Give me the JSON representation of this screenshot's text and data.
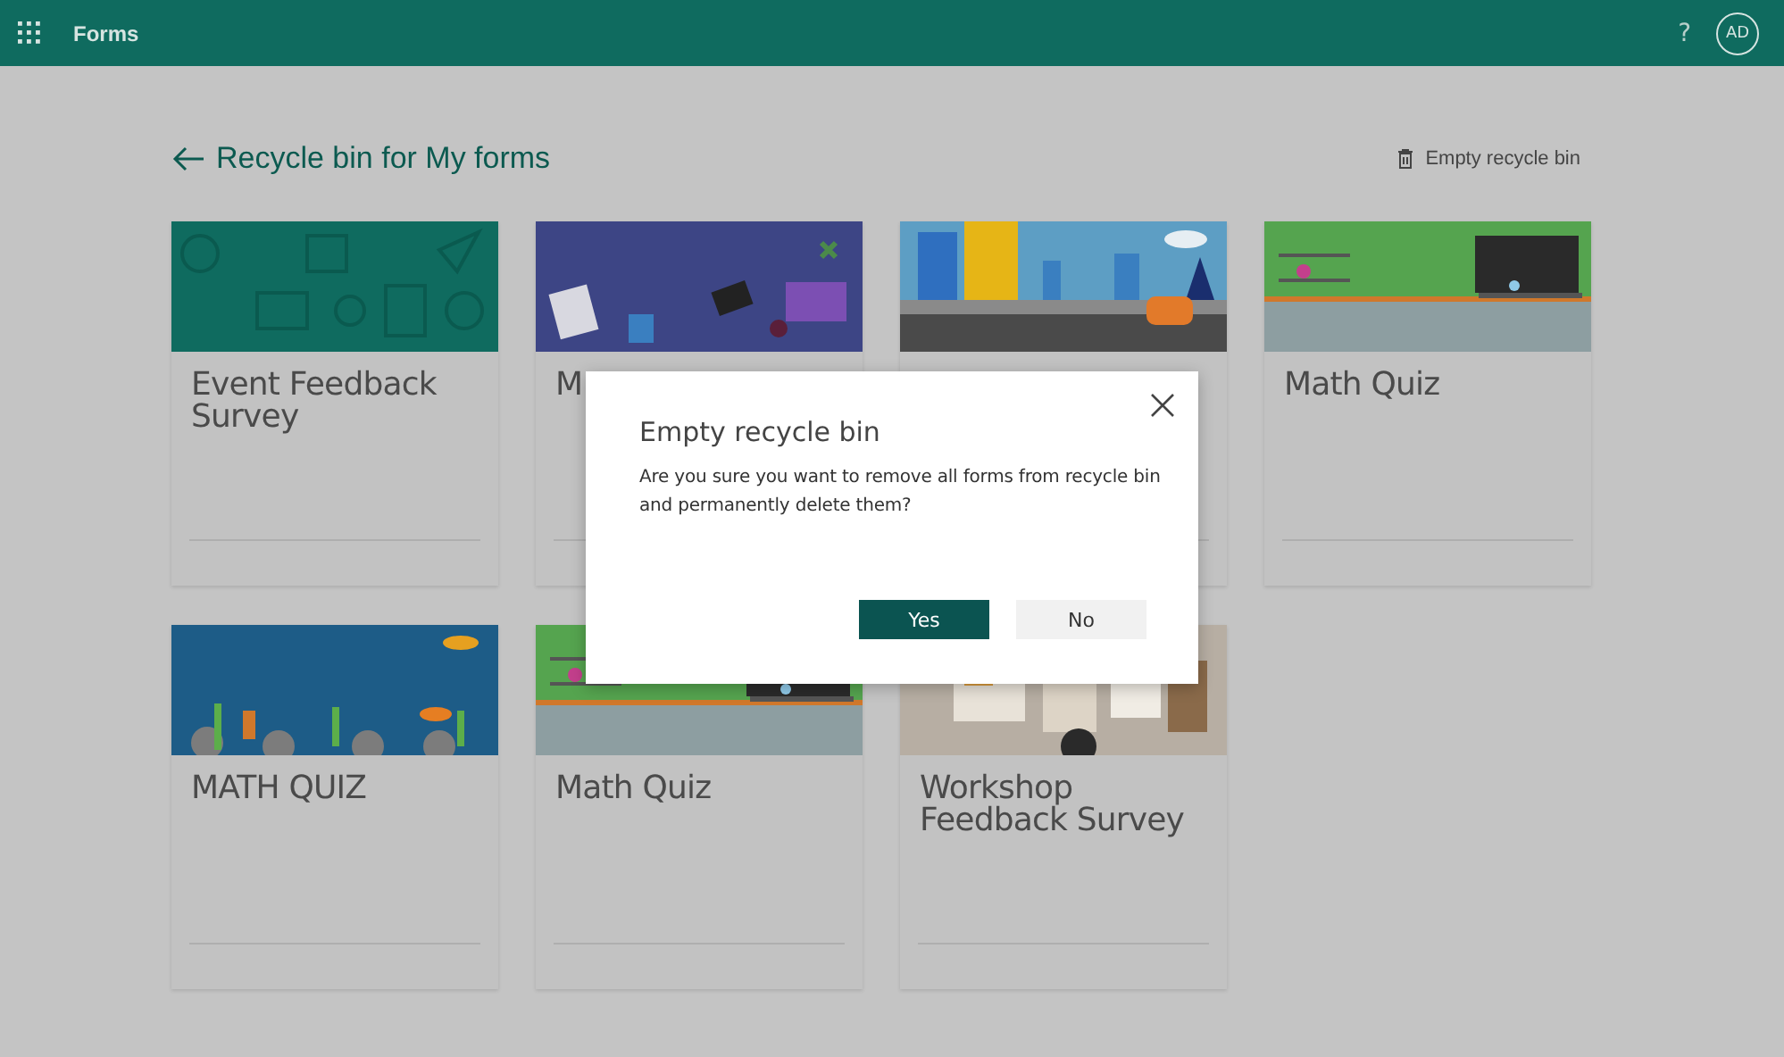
{
  "header": {
    "app_title": "Forms",
    "help": "?",
    "avatar": "AD"
  },
  "page": {
    "back_title": "Recycle bin for My forms",
    "empty_action": "Empty recycle bin"
  },
  "cards": [
    {
      "banner": {
        "kind": "picture"
      },
      "title": "Event Feedback Survey"
    },
    {
      "banner": {
        "kind": "picture"
      },
      "title": "M"
    },
    {
      "banner": {
        "kind": "picture"
      }
    },
    {
      "banner": {
        "kind": "picture"
      },
      "title": "Math Quiz"
    },
    {
      "banner": {
        "kind": "picture"
      },
      "title": "MATH QUIZ"
    },
    {
      "banner": {
        "kind": "picture"
      },
      "title": "Math Quiz"
    },
    {
      "banner": {
        "kind": "picture"
      },
      "title": "Workshop Feedback Survey"
    }
  ],
  "dialog": {
    "title": "Empty recycle bin",
    "message": "Are you sure you want to remove all forms from recycle bin and permanently delete them?",
    "buttons": [
      {
        "label": "Yes",
        "kind": "primary"
      },
      {
        "label": "No",
        "kind": "secondary"
      }
    ]
  }
}
